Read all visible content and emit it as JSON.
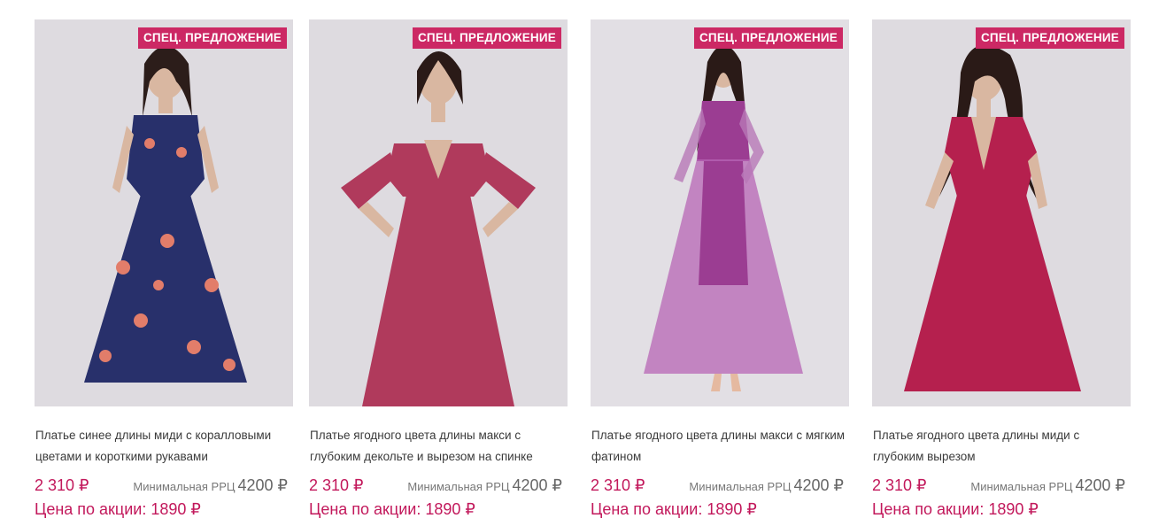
{
  "products": [
    {
      "badge": "СПЕЦ. ПРЕДЛОЖЕНИЕ",
      "title": "Платье синее длины миди с коралловыми цветами и короткими рукавами",
      "price": "2 310 ₽",
      "rrc_label": "Минимальная РРЦ",
      "rrc_value": "4200 ₽",
      "promo": "Цена по акции: 1890 ₽",
      "image_icon": "dress-blue-floral-photo",
      "dress_color": "#28306b"
    },
    {
      "badge": "СПЕЦ. ПРЕДЛОЖЕНИЕ",
      "title": "Платье ягодного цвета длины макси с глубоким декольте и вырезом на спинке",
      "price": "2 310 ₽",
      "rrc_label": "Минимальная РРЦ",
      "rrc_value": "4200 ₽",
      "promo": "Цена по акции: 1890 ₽",
      "image_icon": "dress-berry-maxi-photo",
      "dress_color": "#b03a5c"
    },
    {
      "badge": "СПЕЦ. ПРЕДЛОЖЕНИЕ",
      "title": "Платье ягодного цвета длины макси с мягким фатином",
      "price": "2 310 ₽",
      "rrc_label": "Минимальная РРЦ",
      "rrc_value": "4200 ₽",
      "promo": "Цена по акции: 1890 ₽",
      "image_icon": "dress-berry-tulle-photo",
      "dress_color": "#a04a9a"
    },
    {
      "badge": "СПЕЦ. ПРЕДЛОЖЕНИЕ",
      "title": "Платье ягодного цвета длины миди с глубоким вырезом",
      "price": "2 310 ₽",
      "rrc_label": "Минимальная РРЦ",
      "rrc_value": "4200 ₽",
      "promo": "Цена по акции: 1890 ₽",
      "image_icon": "dress-berry-midi-photo",
      "dress_color": "#b5204e"
    }
  ],
  "colors": {
    "accent": "#c2185b",
    "badge_bg": "#cc2864",
    "photo_bg": "#dcdadd"
  }
}
